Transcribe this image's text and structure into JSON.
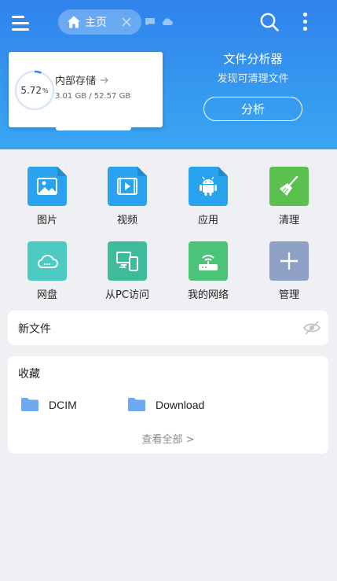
{
  "header": {
    "home_tab_label": "主页"
  },
  "storage": {
    "percent_text": "5.72",
    "percent_unit": "%",
    "percent_value": 5.72,
    "title": "内部存储",
    "size_text": "3.01 GB / 52.57 GB"
  },
  "analyzer": {
    "title": "文件分析器",
    "subtitle": "发现可清理文件",
    "button_label": "分析"
  },
  "categories": [
    {
      "label": "图片",
      "icon": "image-icon",
      "color": "#2aa3ee"
    },
    {
      "label": "视频",
      "icon": "video-icon",
      "color": "#2aa3ee"
    },
    {
      "label": "应用",
      "icon": "android-icon",
      "color": "#2aa3ee"
    },
    {
      "label": "清理",
      "icon": "broom-icon",
      "color": "#5cc04e"
    },
    {
      "label": "网盘",
      "icon": "cloud-icon",
      "color": "#4ccbc2"
    },
    {
      "label": "从PC访问",
      "icon": "pc-access-icon",
      "color": "#3dbb9a"
    },
    {
      "label": "我的网络",
      "icon": "router-icon",
      "color": "#4bc478"
    },
    {
      "label": "管理",
      "icon": "plus-icon",
      "color": "#8ea0c6"
    }
  ],
  "new_files": {
    "title": "新文件"
  },
  "favorites": {
    "title": "收藏",
    "items": [
      {
        "name": "DCIM"
      },
      {
        "name": "Download"
      }
    ],
    "view_all": "查看全部 >"
  },
  "colors": {
    "header_top": "#2f83ec",
    "header_bottom": "#3aa6f2",
    "folder": "#6ea8f0",
    "ring_progress": "#2f83ec"
  }
}
